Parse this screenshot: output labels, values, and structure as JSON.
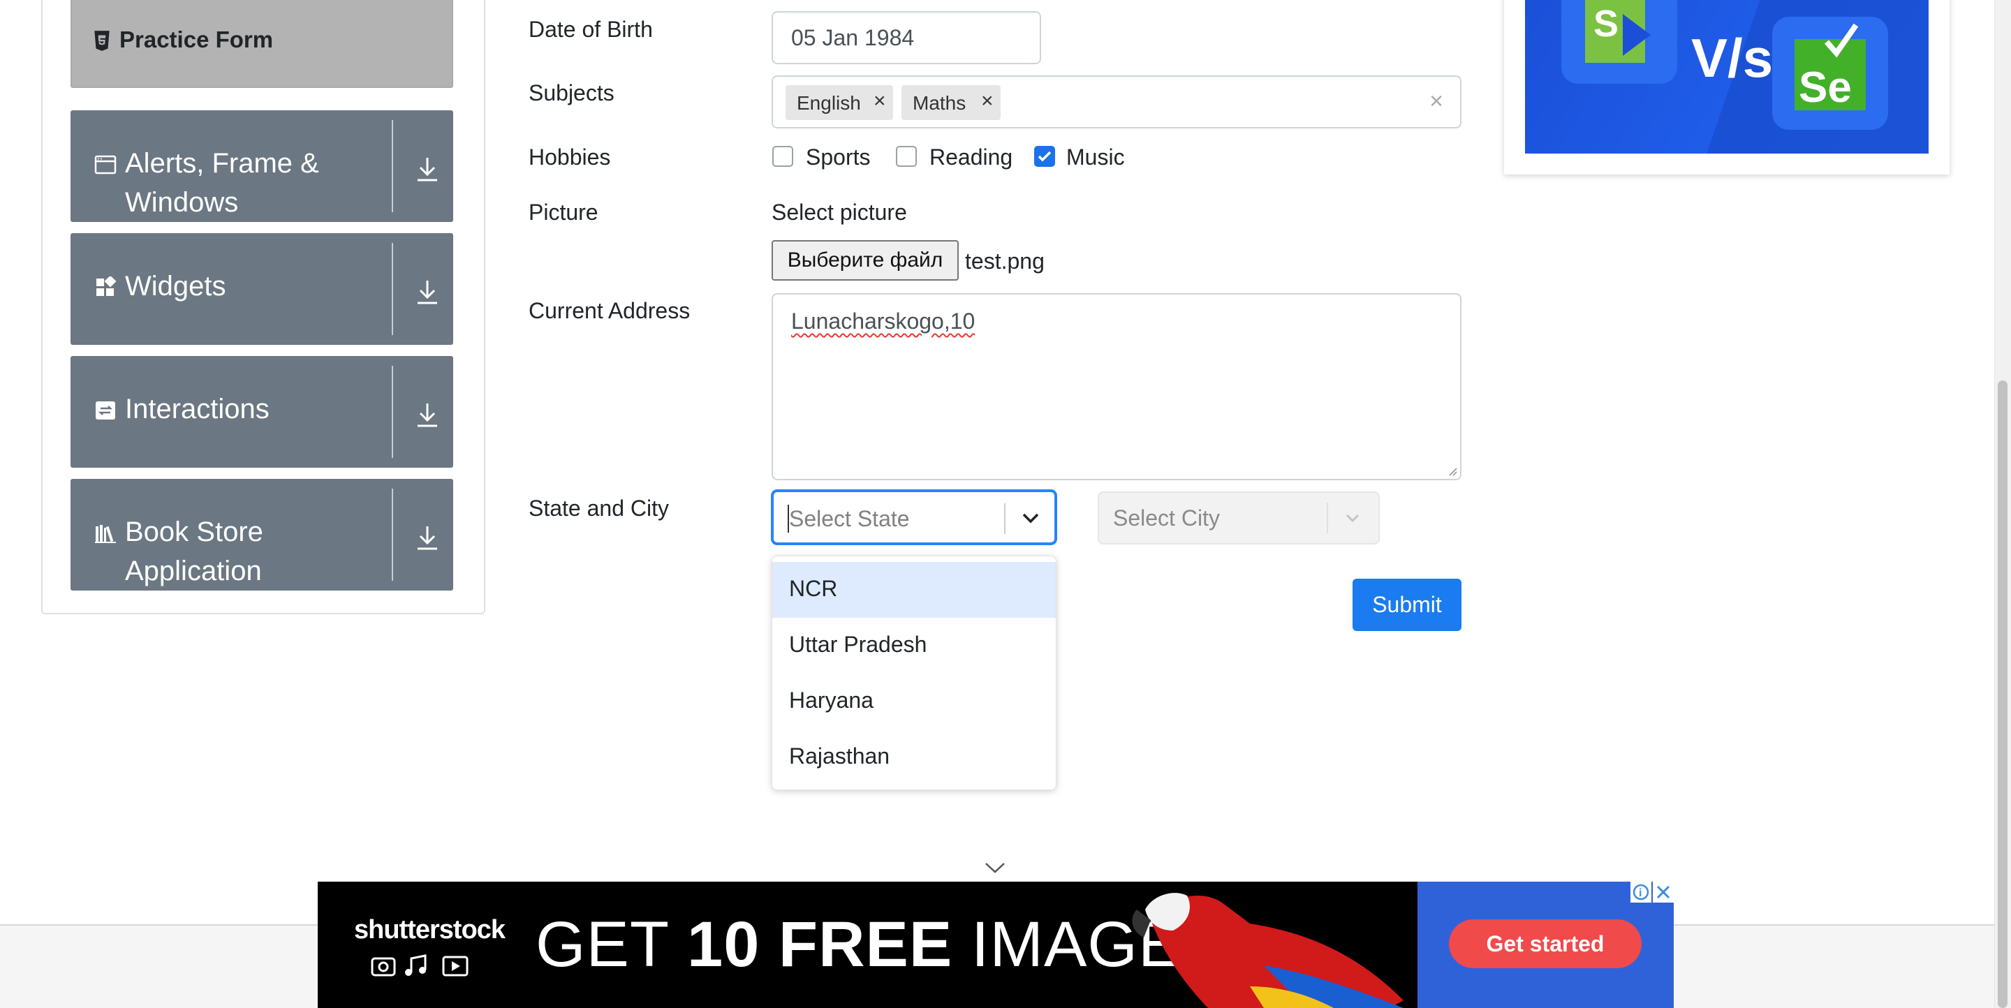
{
  "sidebar": {
    "active_item": "Practice Form",
    "groups": [
      {
        "label": "Alerts, Frame & Windows",
        "icon": "window-icon"
      },
      {
        "label": "Widgets",
        "icon": "widgets-icon"
      },
      {
        "label": "Interactions",
        "icon": "interactions-icon"
      },
      {
        "label": "Book Store Application",
        "icon": "bookstore-icon"
      }
    ]
  },
  "form": {
    "dob": {
      "label": "Date of Birth",
      "value": "05 Jan 1984"
    },
    "subjects": {
      "label": "Subjects",
      "chips": [
        "English",
        "Maths"
      ],
      "remove_glyph": "×",
      "clear_glyph": "×"
    },
    "hobbies": {
      "label": "Hobbies",
      "options": [
        {
          "label": "Sports",
          "checked": false
        },
        {
          "label": "Reading",
          "checked": false
        },
        {
          "label": "Music",
          "checked": true
        }
      ]
    },
    "picture": {
      "label": "Picture",
      "hint": "Select picture",
      "button": "Выберите файл",
      "filename": "test.png"
    },
    "address": {
      "label": "Current Address",
      "value": "Lunacharskogo,10"
    },
    "state_city": {
      "label": "State and City",
      "state_placeholder": "Select State",
      "city_placeholder": "Select City",
      "options": [
        "NCR",
        "Uttar Pradesh",
        "Haryana",
        "Rajasthan"
      ],
      "highlighted": "NCR"
    },
    "submit": "Submit"
  },
  "banner": {
    "brand": "shutterstock",
    "headline_pre": "GET ",
    "headline_bold": "10 FREE",
    "headline_post": " IMAGES",
    "cta": "Get started"
  },
  "colors": {
    "accent": "#1a7cf0",
    "sidebar_group": "#6b7782",
    "cta": "#f04a4a"
  }
}
